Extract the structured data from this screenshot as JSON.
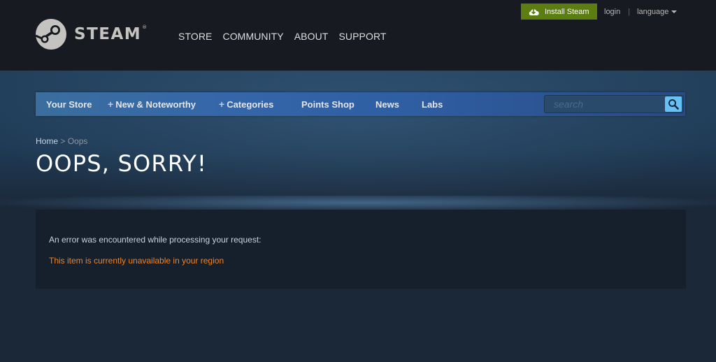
{
  "header": {
    "logo_text": "STEAM",
    "logo_reg": "®",
    "menu": [
      "STORE",
      "COMMUNITY",
      "ABOUT",
      "SUPPORT"
    ],
    "install_label": "Install Steam",
    "login_label": "login",
    "separator": "|",
    "language_label": "language"
  },
  "store_nav": {
    "tabs": [
      {
        "label": "Your Store",
        "plus": false
      },
      {
        "label": "New & Noteworthy",
        "plus": true
      },
      {
        "label": "Categories",
        "plus": true
      },
      {
        "label": "Points Shop",
        "plus": false
      },
      {
        "label": "News",
        "plus": false
      },
      {
        "label": "Labs",
        "plus": false
      }
    ],
    "plus_glyph": "+",
    "search_placeholder": "search"
  },
  "breadcrumb": {
    "home": "Home",
    "separator": " > ",
    "current": "Oops"
  },
  "page_title": "OOPS, SORRY!",
  "error": {
    "intro": "An error was encountered while processing your request:",
    "message": "This item is currently unavailable in your region"
  },
  "colors": {
    "header_bg": "#171a21",
    "page_bg": "#1b2838",
    "install_green": "#5c7e10",
    "nav_blue": "#3566a9",
    "search_button": "#67c1f5",
    "error_orange": "#f5821f"
  },
  "icons": {
    "logo": "steam-logo-icon",
    "install": "download-cloud-icon",
    "language": "caret-down-icon",
    "plus": "plus-icon",
    "search": "magnifier-icon"
  }
}
